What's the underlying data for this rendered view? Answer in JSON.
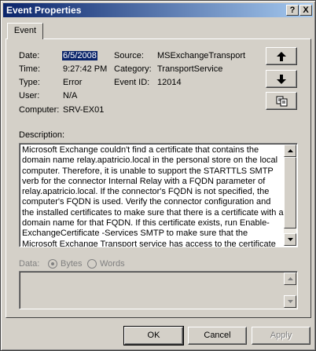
{
  "window": {
    "title": "Event Properties",
    "help_glyph": "?",
    "close_glyph": "X"
  },
  "tab": {
    "label": "Event"
  },
  "fields": {
    "date_label": "Date:",
    "date_value": "6/5/2008",
    "time_label": "Time:",
    "time_value": "9:27:42 PM",
    "type_label": "Type:",
    "type_value": "Error",
    "user_label": "User:",
    "user_value": "N/A",
    "computer_label": "Computer:",
    "computer_value": "SRV-EX01",
    "source_label": "Source:",
    "source_value": "MSExchangeTransport",
    "category_label": "Category:",
    "category_value": "TransportService",
    "eventid_label": "Event ID:",
    "eventid_value": "12014"
  },
  "description": {
    "label": "Description:",
    "text": "Microsoft Exchange couldn't find a certificate that contains the domain name relay.apatricio.local in the personal store on the local computer. Therefore, it is unable to support the STARTTLS SMTP verb for the connector Internal Relay with a FQDN parameter of relay.apatricio.local. If the connector's FQDN is not specified, the computer's FQDN is used. Verify the connector configuration and the installed certificates to make sure that there is a certificate with a domain name for that FQDN. If this certificate exists, run Enable-ExchangeCertificate -Services SMTP to make sure that the Microsoft Exchange Transport service has access to the certificate key."
  },
  "data_section": {
    "label": "Data:",
    "bytes_label": "Bytes",
    "words_label": "Words"
  },
  "buttons": {
    "ok": "OK",
    "cancel": "Cancel",
    "apply": "Apply"
  },
  "icons": {
    "up": "up-arrow-icon",
    "down": "down-arrow-icon",
    "copy": "copy-icon"
  }
}
